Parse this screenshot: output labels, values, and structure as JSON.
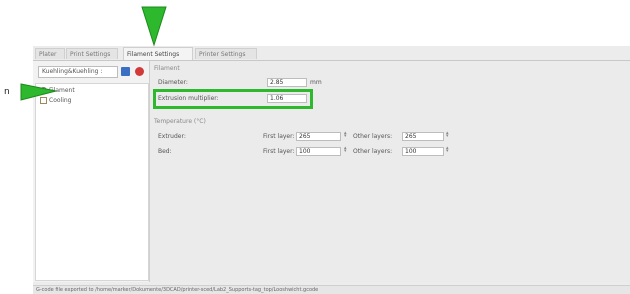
{
  "tabs": [
    "Plater",
    "Print Settings",
    "Filament Settings",
    "Printer Settings"
  ],
  "active_tab": "Filament Settings",
  "preset": {
    "value": "Kuehling&Kuehling :"
  },
  "tree": {
    "items": [
      "Filament",
      "Cooling"
    ]
  },
  "filament_section": {
    "title": "Filament",
    "diameter": {
      "label": "Diameter:",
      "value": "2.85",
      "unit": "mm"
    },
    "extrusion_multiplier": {
      "label": "Extrusion multiplier:",
      "value": "1.06"
    }
  },
  "temperature_section": {
    "title": "Temperature (°C)",
    "first_layer_label": "First layer:",
    "other_layers_label": "Other layers:",
    "extruder": {
      "label": "Extruder:",
      "first_layer": "265",
      "other_layers": "265"
    },
    "bed": {
      "label": "Bed:",
      "first_layer": "100",
      "other_layers": "100"
    }
  },
  "status_bar": {
    "text": "G-code file exported to /home/marker/Dokumente/3DCAD/printer-sced/Lab2_Supports-tag_top/Looshwicht.gcode"
  },
  "annotation": {
    "left_text": "n",
    "color": "#2db82d"
  },
  "colors": {
    "highlight": "#2db82d",
    "save_icon": "#3a6fc4",
    "delete_icon": "#d23a3a"
  }
}
